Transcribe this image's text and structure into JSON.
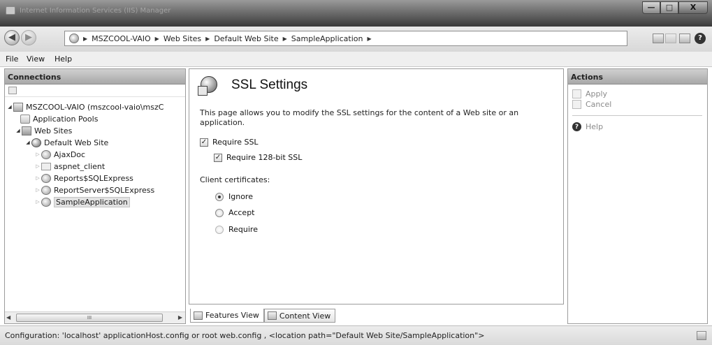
{
  "window": {
    "title": "Internet Information Services (IIS) Manager",
    "min_label": "—",
    "max_label": "□",
    "close_label": "X"
  },
  "nav": {
    "back_label": "◀",
    "forward_label": "▶"
  },
  "breadcrumb": [
    "MSZCOOL-VAIO",
    "Web Sites",
    "Default Web Site",
    "SampleApplication"
  ],
  "breadcrumb_sep": "▶",
  "toolbar": {
    "help_label": "?"
  },
  "menu": {
    "file": "File",
    "view": "View",
    "help": "Help"
  },
  "connections": {
    "header": "Connections",
    "tree": {
      "server": "MSZCOOL-VAIO (mszcool-vaio\\mszC",
      "app_pools": "Application Pools",
      "web_sites": "Web Sites",
      "default_site": "Default Web Site",
      "ajaxdoc": "AjaxDoc",
      "aspnet_client": "aspnet_client",
      "reports": "Reports$SQLExpress",
      "reportserver": "ReportServer$SQLExpress",
      "sample": "SampleApplication"
    },
    "scroll_thumb": "III",
    "scroll_left": "◀",
    "scroll_right": "▶"
  },
  "content": {
    "title": "SSL Settings",
    "description": "This page allows you to modify the SSL settings for the content of a Web site or an application.",
    "require_ssl_label": "Require SSL",
    "require_ssl_checked": true,
    "require_128_label": "Require 128-bit SSL",
    "require_128_checked": true,
    "client_cert_label": "Client certificates:",
    "radios": [
      {
        "label": "Ignore",
        "checked": true
      },
      {
        "label": "Accept",
        "checked": false
      },
      {
        "label": "Require",
        "checked": false
      }
    ],
    "checkmark": "✓"
  },
  "view_tabs": {
    "features": "Features View",
    "content": "Content View"
  },
  "actions": {
    "header": "Actions",
    "apply": "Apply",
    "cancel": "Cancel",
    "help": "Help",
    "help_icon": "?"
  },
  "status": {
    "text": "Configuration: 'localhost' applicationHost.config or root web.config , <location path=\"Default Web Site/SampleApplication\">"
  }
}
